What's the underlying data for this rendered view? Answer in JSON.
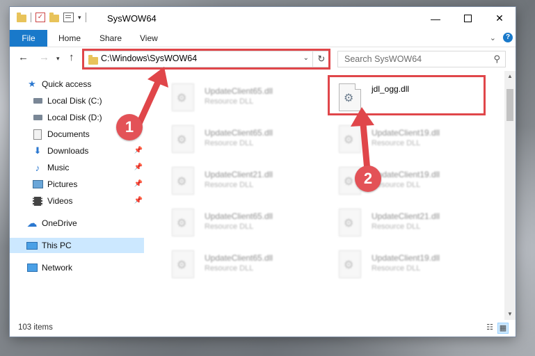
{
  "window": {
    "title": "SysWOW64"
  },
  "ribbon": {
    "tabs": [
      "File",
      "Home",
      "Share",
      "View"
    ],
    "help_label": "?"
  },
  "nav": {
    "address": "C:\\Windows\\SysWOW64",
    "search_placeholder": "Search SysWOW64"
  },
  "sidebar": {
    "items": [
      {
        "label": "Quick access",
        "icon": "star-icon"
      },
      {
        "label": "Local Disk (C:)",
        "icon": "drive-icon"
      },
      {
        "label": "Local Disk (D:)",
        "icon": "drive-icon"
      },
      {
        "label": "Documents",
        "icon": "documents-icon"
      },
      {
        "label": "Downloads",
        "icon": "download-icon",
        "pinned": true
      },
      {
        "label": "Music",
        "icon": "music-icon",
        "pinned": true
      },
      {
        "label": "Pictures",
        "icon": "pictures-icon",
        "pinned": true
      },
      {
        "label": "Videos",
        "icon": "videos-icon",
        "pinned": true
      },
      {
        "label": "OneDrive",
        "icon": "cloud-icon"
      },
      {
        "label": "This PC",
        "icon": "computer-icon",
        "selected": true
      },
      {
        "label": "Network",
        "icon": "network-icon"
      }
    ]
  },
  "files": {
    "left": [
      {
        "name": "UpdateClient65.dll",
        "type": "Resource DLL"
      },
      {
        "name": "UpdateClient65.dll",
        "type": "Resource DLL"
      },
      {
        "name": "UpdateClient21.dll",
        "type": "Resource DLL"
      },
      {
        "name": "UpdateClient65.dll",
        "type": "Resource DLL"
      },
      {
        "name": "UpdateClient65.dll",
        "type": "Resource DLL"
      }
    ],
    "right": [
      {
        "name": "jdl_ogg.dll",
        "type": ""
      },
      {
        "name": "UpdateClient19.dll",
        "type": "Resource DLL"
      },
      {
        "name": "UpdateClient19.dll",
        "type": "Resource DLL"
      },
      {
        "name": "UpdateClient21.dll",
        "type": "Resource DLL"
      },
      {
        "name": "UpdateClient19.dll",
        "type": "Resource DLL"
      }
    ]
  },
  "status": {
    "item_count": "103 items"
  },
  "annotations": {
    "badge1": "1",
    "badge2": "2",
    "color": "#e0464a"
  }
}
